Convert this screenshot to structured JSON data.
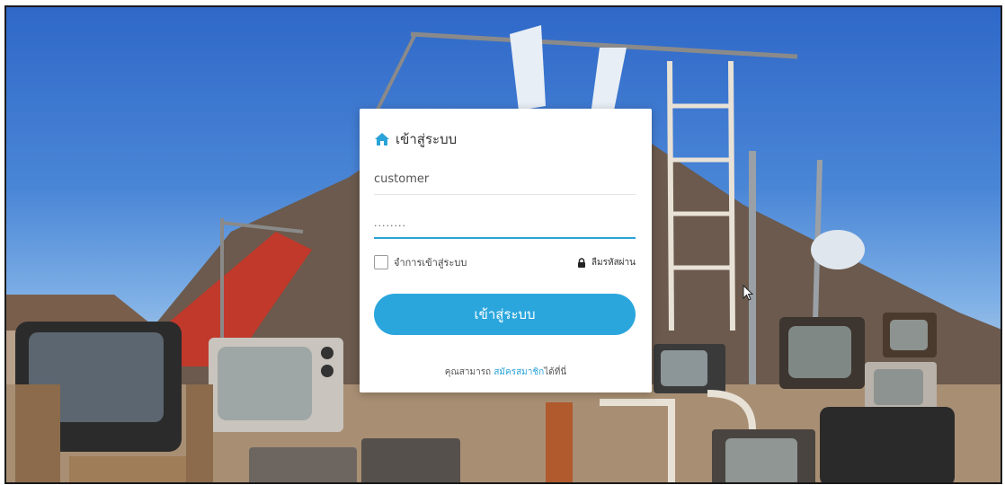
{
  "login": {
    "title": "เข้าสู่ระบบ",
    "username_value": "customer",
    "password_value": "........",
    "remember_label": "จำการเข้าสู่ระบบ",
    "forgot_label": "ลืมรหัสผ่าน",
    "submit_label": "เข้าสู่ระบบ",
    "signup_prefix": "คุณสามารถ",
    "signup_link": "สมัครสมาชิก",
    "signup_suffix": "ได้ที่นี่"
  },
  "icons": {
    "title_icon": "home-icon",
    "forgot_icon": "lock-icon",
    "pointer": "cursor-arrow-icon"
  },
  "colors": {
    "accent": "#2aa6dd",
    "title_icon": "#2aa3d8",
    "sky": "#3a74cc"
  }
}
